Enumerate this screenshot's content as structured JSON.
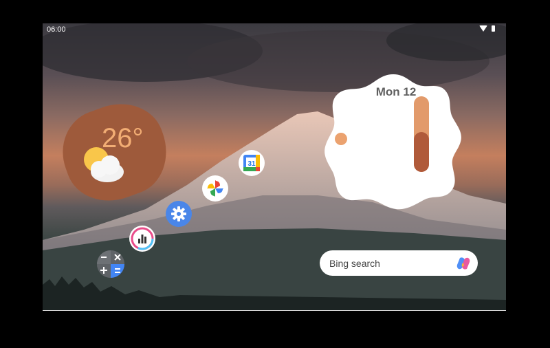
{
  "status_bar": {
    "time": "06:00",
    "wifi_icon": "wifi-icon",
    "battery_icon": "battery-icon"
  },
  "weather_widget": {
    "temperature": "26°",
    "condition_icon": "partly-cloudy-icon"
  },
  "clock_widget": {
    "date": "Mon 12"
  },
  "apps": [
    {
      "name": "calendar",
      "label_icon": "calendar-icon",
      "day": "31"
    },
    {
      "name": "photos",
      "label_icon": "photos-icon"
    },
    {
      "name": "settings",
      "label_icon": "gear-icon"
    },
    {
      "name": "stats",
      "label_icon": "bar-chart-icon"
    },
    {
      "name": "calculator",
      "label_icon": "calculator-icon"
    }
  ],
  "search": {
    "placeholder": "Bing search",
    "assistant_icon": "copilot-icon"
  },
  "colors": {
    "weather_bg": "#9e5a3b",
    "temp_text": "#f2ad74",
    "clock_hand": "#e29a6b",
    "clock_hand_dark": "#b05a3a"
  }
}
